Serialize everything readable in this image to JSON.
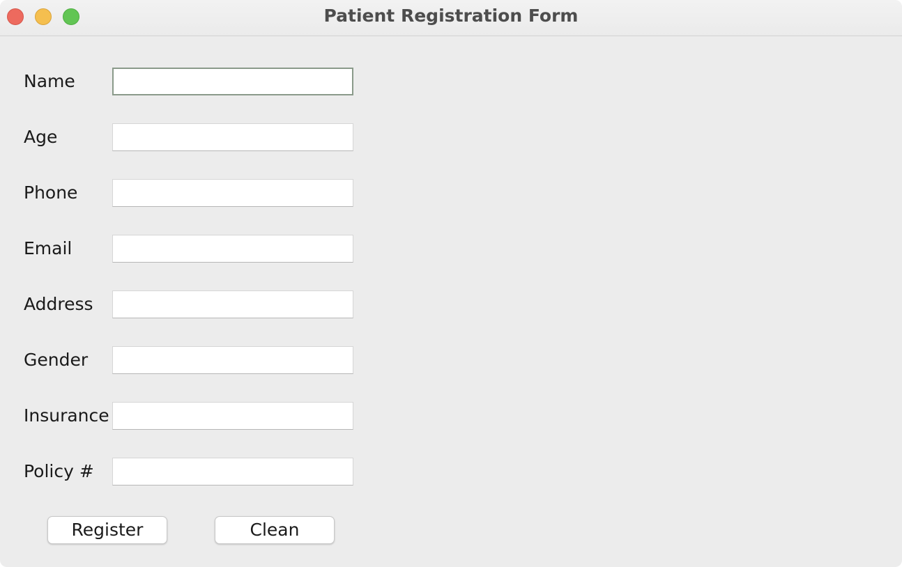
{
  "window": {
    "title": "Patient Registration Form"
  },
  "form": {
    "fields": [
      {
        "label": "Name",
        "value": "",
        "focused": true
      },
      {
        "label": "Age",
        "value": ""
      },
      {
        "label": "Phone",
        "value": ""
      },
      {
        "label": "Email",
        "value": ""
      },
      {
        "label": "Address",
        "value": ""
      },
      {
        "label": "Gender",
        "value": ""
      },
      {
        "label": "Insurance",
        "value": ""
      },
      {
        "label": "Policy #",
        "value": ""
      }
    ]
  },
  "buttons": {
    "register_label": "Register",
    "clean_label": "Clean"
  },
  "colors": {
    "background": "#ececec",
    "close": "#ed6a5e",
    "minimize": "#f5bf4f",
    "zoom": "#62c554",
    "focus_border": "#8a9a8a"
  }
}
